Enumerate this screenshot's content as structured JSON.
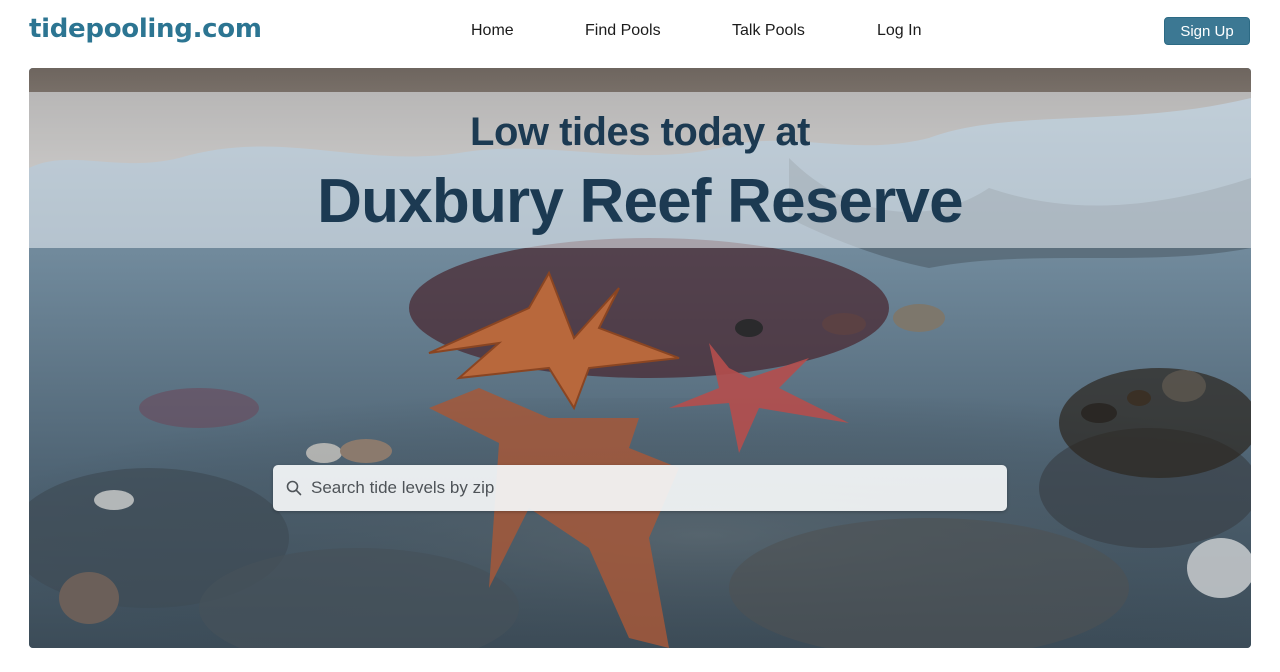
{
  "brand": {
    "logo_text": "tidepooling.com",
    "accent_color": "#2c7592"
  },
  "nav": {
    "items": [
      {
        "label": "Home"
      },
      {
        "label": "Find Pools"
      },
      {
        "label": "Talk Pools"
      },
      {
        "label": "Log In"
      }
    ]
  },
  "header": {
    "signup_label": "Sign Up",
    "signup_color": "#3c7893"
  },
  "hero": {
    "headline": "Low tides today at",
    "location": "Duxbury Reef Reserve",
    "text_color": "#1c3a52",
    "image_subject": "starfish in tide pool"
  },
  "search": {
    "placeholder": "Search tide levels by zip",
    "value": "",
    "icon": "search-icon"
  }
}
